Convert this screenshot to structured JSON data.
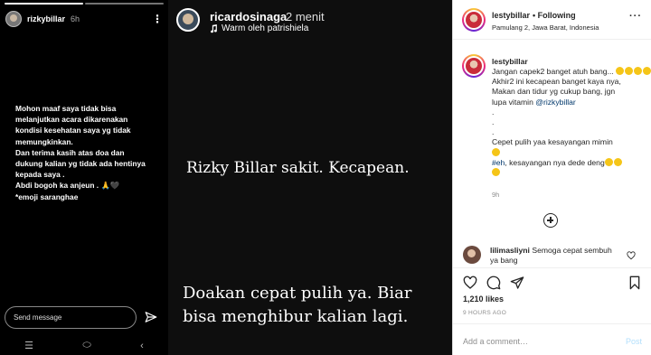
{
  "story1": {
    "username": "rizkybillar",
    "time": "6h",
    "message_lines": [
      "Mohon maaf saya tidak bisa",
      "melanjutkan acara dikarenakan",
      "kondisi kesehatan saya yg tidak",
      "memungkinkan.",
      "Dan terima kasih atas doa dan",
      "dukung kalian yg tidak ada hentinya",
      "kepada saya .",
      "Abdi bogoh ka anjeun . 🙏🖤",
      "*emoji saranghae"
    ],
    "send_placeholder": "Send message"
  },
  "story2": {
    "username": "ricardosinaga",
    "time": "2 menit",
    "music": "Warm oleh patrishiela",
    "text_top": "Rizky Billar sakit. Kecapean.",
    "text_bottom_1": "Doakan cepat pulih ya. Biar",
    "text_bottom_2": "bisa menghibur kalian lagi."
  },
  "post": {
    "username": "lestybillar",
    "follow_label": "• Following",
    "location": "Pamulang 2, Jawa Barat, Indonesia",
    "caption_lines": [
      "Jangan capek2 banget atuh bang...",
      "Akhir2 ini kecapean banget kaya nya,",
      "Makan dan tidur yg cukup bang, jgn",
      "lupa vitamin"
    ],
    "mention": "@rizkybillar",
    "caption_dots": [
      ".",
      ".",
      "."
    ],
    "caption_line2": "Cepet pulih yaa kesayangan mimin",
    "hashtag": "#eh",
    "caption_line3": ", kesayangan nya dede deng",
    "caption_age": "9h",
    "comment_user": "lilimasliyni",
    "comment_text": "Semoga cepat sembuh ya bang",
    "likes": "1,210 likes",
    "when": "9 HOURS AGO",
    "add_comment_placeholder": "Add a comment…",
    "post_label": "Post"
  }
}
